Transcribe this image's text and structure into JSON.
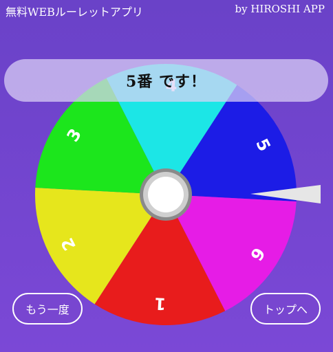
{
  "header": {
    "app_title": "無料WEBルーレットアプリ",
    "byline": "by HIROSHI APP"
  },
  "result_banner": {
    "text": "5番 です！"
  },
  "wheel": {
    "segments": [
      {
        "label": "1",
        "color": "#e81c1c"
      },
      {
        "label": "2",
        "color": "#e6e61c"
      },
      {
        "label": "3",
        "color": "#1ce61c"
      },
      {
        "label": "4",
        "color": "#1ce6e6"
      },
      {
        "label": "5",
        "color": "#1c1ce6"
      },
      {
        "label": "6",
        "color": "#e61ce6"
      }
    ]
  },
  "buttons": {
    "retry_label": "もう一度",
    "top_label": "トップへ"
  }
}
